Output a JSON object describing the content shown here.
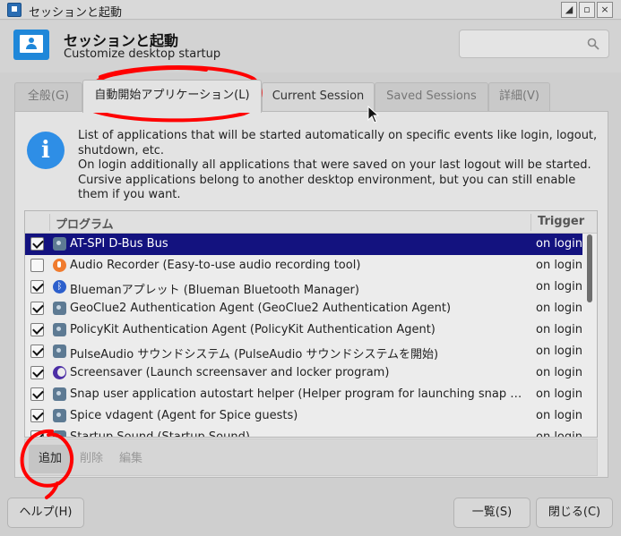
{
  "window": {
    "title": "セッションと起動",
    "controls": [
      "◢",
      "▫",
      "×"
    ]
  },
  "header": {
    "title": "セッションと起動",
    "subtitle": "Customize desktop startup",
    "search_placeholder": ""
  },
  "tabs": [
    {
      "label": "全般(G)",
      "active": false
    },
    {
      "label": "自動開始アプリケーション(L)",
      "active": true
    },
    {
      "label": "Current Session",
      "active": false
    },
    {
      "label": "Saved Sessions",
      "active": false
    },
    {
      "label": "詳細(V)",
      "active": false
    }
  ],
  "info": {
    "lines": [
      "List of applications that will be started automatically on specific events like login, logout, shutdown, etc.",
      "On login additionally all applications that were saved on your last logout will be started.",
      "Cursive applications belong to another desktop environment, but you can still enable them if you want."
    ]
  },
  "table": {
    "headers": {
      "program": "プログラム",
      "trigger": "Trigger"
    },
    "rows": [
      {
        "checked": true,
        "icon": "gear-icon",
        "name": "AT-SPI D-Bus Bus",
        "trigger": "on login",
        "selected": true
      },
      {
        "checked": false,
        "icon": "microphone-icon",
        "name": "Audio Recorder (Easy-to-use audio recording tool)",
        "trigger": "on login",
        "selected": false
      },
      {
        "checked": true,
        "icon": "bluetooth-icon",
        "name": "Bluemanアプレット (Blueman Bluetooth Manager)",
        "trigger": "on login",
        "selected": false
      },
      {
        "checked": true,
        "icon": "gear-icon",
        "name": "GeoClue2 Authentication Agent (GeoClue2 Authentication Agent)",
        "trigger": "on login",
        "selected": false
      },
      {
        "checked": true,
        "icon": "gear-icon",
        "name": "PolicyKit Authentication Agent (PolicyKit Authentication Agent)",
        "trigger": "on login",
        "selected": false
      },
      {
        "checked": true,
        "icon": "gear-icon",
        "name": "PulseAudio サウンドシステム (PulseAudio サウンドシステムを開始)",
        "trigger": "on login",
        "selected": false
      },
      {
        "checked": true,
        "icon": "moon-icon",
        "name": "Screensaver (Launch screensaver and locker program)",
        "trigger": "on login",
        "selected": false
      },
      {
        "checked": true,
        "icon": "gear-icon",
        "name": "Snap user application autostart helper (Helper program for launching snap ap...",
        "trigger": "on login",
        "selected": false
      },
      {
        "checked": true,
        "icon": "gear-icon",
        "name": "Spice vdagent (Agent for Spice guests)",
        "trigger": "on login",
        "selected": false
      },
      {
        "checked": true,
        "icon": "gear-icon",
        "name": "Startup Sound (Startup Sound)",
        "trigger": "on login",
        "selected": false
      }
    ]
  },
  "toolbar": {
    "add_label": "追加",
    "remove_label": "削除",
    "edit_label": "編集"
  },
  "buttons": {
    "help_label": "ヘルプ(H)",
    "list_label": "一覧(S)",
    "close_label": "閉じる(C)"
  },
  "colors": {
    "selection": "#13127f",
    "annotation": "#ff0000",
    "info": "#2e8ee6"
  }
}
